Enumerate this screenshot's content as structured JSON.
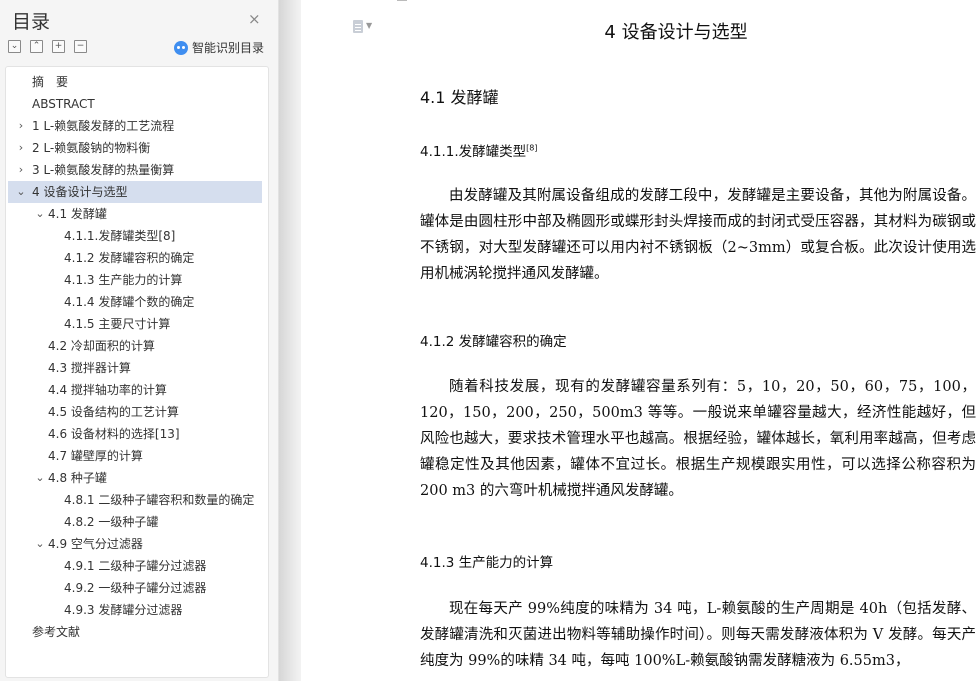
{
  "sidebar": {
    "title": "目录",
    "close_icon": "×",
    "tools": {
      "collapse": "⌄",
      "expand": "⌃",
      "add": "+",
      "remove": "−"
    },
    "smart_toc_label": "智能识别目录",
    "items": [
      {
        "label": "摘　要",
        "level": 0,
        "caret": ""
      },
      {
        "label": "ABSTRACT",
        "level": 0,
        "caret": ""
      },
      {
        "label": "1 L-赖氨酸发酵的工艺流程",
        "level": 0,
        "caret": "›"
      },
      {
        "label": "2 L-赖氨酸钠的物料衡",
        "level": 0,
        "caret": "›"
      },
      {
        "label": "3 L-赖氨酸发酵的热量衡算",
        "level": 0,
        "caret": "›"
      },
      {
        "label": "4 设备设计与选型",
        "level": 0,
        "caret": "⌄",
        "active": true
      },
      {
        "label": "4.1 发酵罐",
        "level": 1,
        "caret": "⌄"
      },
      {
        "label": "4.1.1.发酵罐类型[8]",
        "level": 2,
        "caret": ""
      },
      {
        "label": "4.1.2 发酵罐容积的确定",
        "level": 2,
        "caret": ""
      },
      {
        "label": "4.1.3 生产能力的计算",
        "level": 2,
        "caret": ""
      },
      {
        "label": "4.1.4 发酵罐个数的确定",
        "level": 2,
        "caret": ""
      },
      {
        "label": "4.1.5 主要尺寸计算",
        "level": 2,
        "caret": ""
      },
      {
        "label": "4.2 冷却面积的计算",
        "level": 1,
        "caret": ""
      },
      {
        "label": "4.3 搅拌器计算",
        "level": 1,
        "caret": ""
      },
      {
        "label": "4.4 搅拌轴功率的计算",
        "level": 1,
        "caret": ""
      },
      {
        "label": "4.5 设备结构的工艺计算",
        "level": 1,
        "caret": ""
      },
      {
        "label": "4.6 设备材料的选择[13]",
        "level": 1,
        "caret": ""
      },
      {
        "label": "4.7 罐壁厚的计算",
        "level": 1,
        "caret": ""
      },
      {
        "label": "4.8 种子罐",
        "level": 1,
        "caret": "⌄"
      },
      {
        "label": "4.8.1 二级种子罐容积和数量的确定",
        "level": 2,
        "caret": ""
      },
      {
        "label": "4.8.2 一级种子罐",
        "level": 2,
        "caret": ""
      },
      {
        "label": "4.9 空气分过滤器",
        "level": 1,
        "caret": "⌄"
      },
      {
        "label": "4.9.1 二级种子罐分过滤器",
        "level": 2,
        "caret": ""
      },
      {
        "label": "4.9.2 一级种子罐分过滤器",
        "level": 2,
        "caret": ""
      },
      {
        "label": "4.9.3 发酵罐分过滤器",
        "level": 2,
        "caret": ""
      },
      {
        "label": "参考文献",
        "level": 0,
        "caret": ""
      }
    ]
  },
  "document": {
    "chapter_title": "4  设备设计与选型",
    "section_title": "4.1  发酵罐",
    "h_4_1_1": "4.1.1.发酵罐类型",
    "h_4_1_1_sup": "[8]",
    "para_1": "由发酵罐及其附属设备组成的发酵工段中，发酵罐是主要设备，其他为附属设备。罐体是由圆柱形中部及椭圆形或蝶形封头焊接而成的封闭式受压容器，其材料为碳钢或不锈钢，对大型发酵罐还可以用内衬不锈钢板（2~3mm）或复合板。此次设计使用选用机械涡轮搅拌通风发酵罐。",
    "h_4_1_2": "4.1.2  发酵罐容积的确定",
    "para_2": "随着科技发展，现有的发酵罐容量系列有：5，10，20，50，60，75，100，120，150，200，250，500m3 等等。一般说来单罐容量越大，经济性能越好，但风险也越大，要求技术管理水平也越高。根据经验，罐体越长，氧利用率越高，但考虑罐稳定性及其他因素，罐体不宜过长。根据生产规模跟实用性，可以选择公称容积为 200 m3 的六弯叶机械搅拌通风发酵罐。",
    "h_4_1_3": "4.1.3  生产能力的计算",
    "para_3": "现在每天产 99%纯度的味精为 34 吨，L-赖氨酸的生产周期是 40h（包括发酵、发酵罐清洗和灭菌进出物料等辅助操作时间）。则每天需发酵液体积为 V 发酵。每天产纯度为 99%的味精 34 吨，每吨 100%L-赖氨酸钠需发酵糖液为 6.55m3，"
  }
}
